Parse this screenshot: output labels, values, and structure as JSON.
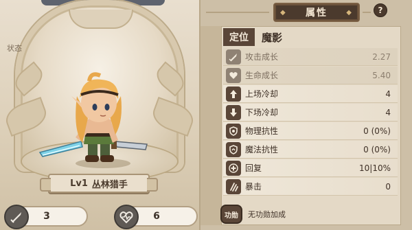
{
  "left": {
    "status_label": "状态",
    "hero": {
      "level": "Lv1",
      "name": "丛林猎手"
    },
    "stats": [
      {
        "icon": "sword-icon",
        "value": "3"
      },
      {
        "icon": "heart-icon",
        "value": "6"
      }
    ]
  },
  "right": {
    "header_title": "属性",
    "help_label": "?",
    "position": {
      "label": "定位",
      "value": "魔影"
    },
    "attributes": [
      {
        "icon": "attack-growth-icon",
        "name": "攻击成长",
        "value": "2.27",
        "dim": true
      },
      {
        "icon": "health-growth-icon",
        "name": "生命成长",
        "value": "5.40",
        "dim": true
      },
      {
        "icon": "arrow-up-icon",
        "name": "上场冷却",
        "value": "4",
        "dim": false
      },
      {
        "icon": "arrow-down-icon",
        "name": "下场冷却",
        "value": "4",
        "dim": false
      },
      {
        "icon": "shield-icon",
        "name": "物理抗性",
        "value": "0 (0%)",
        "dim": false
      },
      {
        "icon": "magic-shield-icon",
        "name": "魔法抗性",
        "value": "0 (0%)",
        "dim": false
      },
      {
        "icon": "plus-icon",
        "name": "回复",
        "value": "10|10%",
        "dim": false
      },
      {
        "icon": "crit-claw-icon",
        "name": "暴击",
        "value": "0",
        "dim": false
      }
    ],
    "merit": {
      "badge": "功勋",
      "text": "无功勋加成"
    }
  },
  "colors": {
    "panel_dark": "#5a4638",
    "panel_light": "#e4d9c6",
    "header_bg": "#4b3a2d",
    "stat_icon_bg": "#5f5a55"
  }
}
